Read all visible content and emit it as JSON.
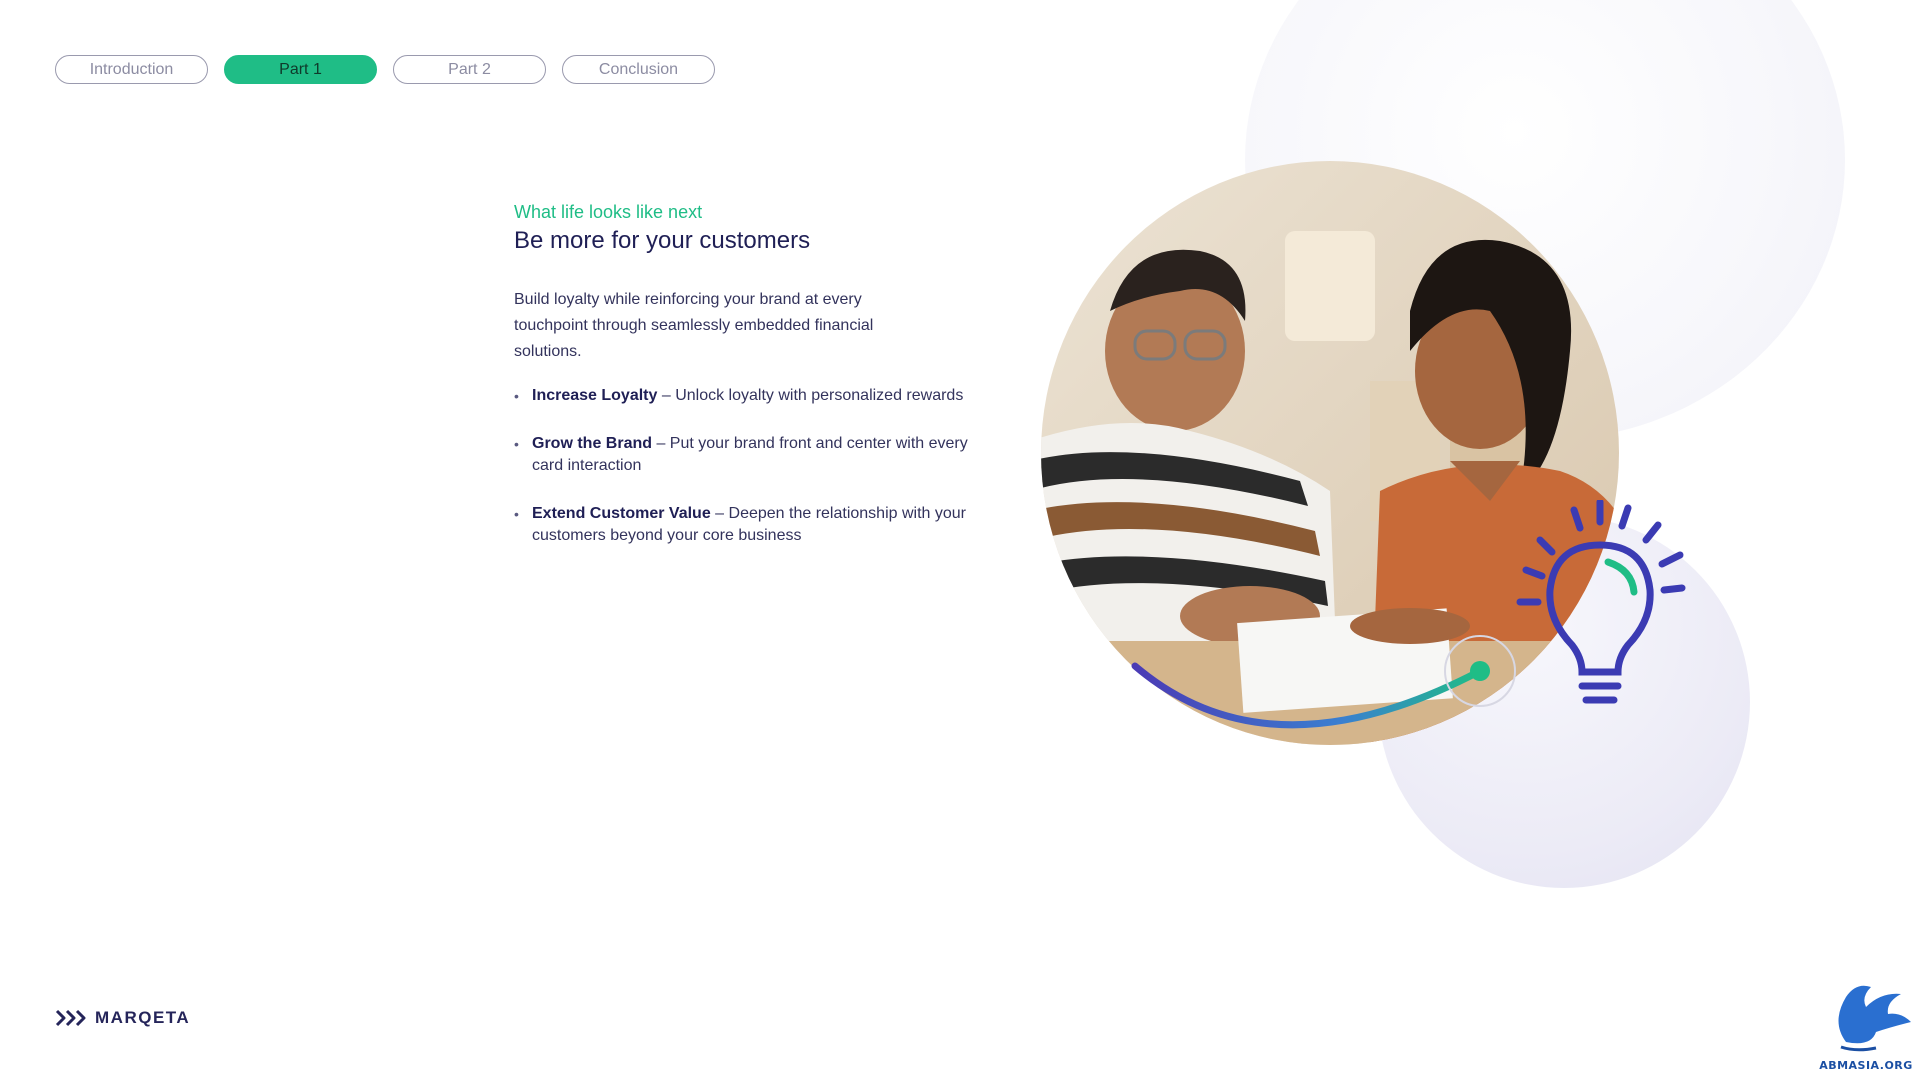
{
  "nav": {
    "items": [
      {
        "label": "Introduction",
        "active": false
      },
      {
        "label": "Part 1",
        "active": true
      },
      {
        "label": "Part 2",
        "active": false
      },
      {
        "label": "Conclusion",
        "active": false
      }
    ]
  },
  "content": {
    "eyebrow": "What life looks like next",
    "title": "Be more for your customers",
    "intro": "Build loyalty while reinforcing your brand at every touchpoint through seamlessly embedded financial solutions.",
    "bullets": [
      {
        "bold": "Increase Loyalty",
        "text": " – Unlock loyalty with personalized rewards"
      },
      {
        "bold": "Grow the Brand",
        "text": " – Put your brand front and center with every card interaction"
      },
      {
        "bold": "Extend Customer Value",
        "text": " – Deepen the relationship with your customers beyond your core business"
      }
    ]
  },
  "brand": {
    "logo_text": "MARQETA"
  },
  "watermark": {
    "text": "ABMASIA.ORG"
  },
  "colors": {
    "accent_green": "#1fbd86",
    "navy": "#1f1f55",
    "bulb_purple": "#3b3bb3"
  },
  "icons": {
    "illustration": "lightbulb-icon",
    "logo": "marqeta-chevrons-icon"
  }
}
